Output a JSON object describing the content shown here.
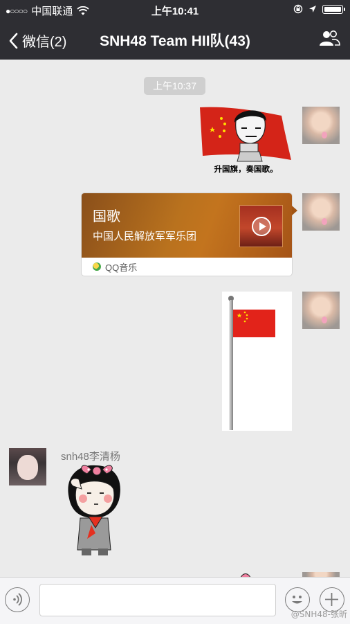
{
  "status_bar": {
    "signal": "●○○○○",
    "carrier": "中国联通",
    "time": "上午10:41"
  },
  "nav": {
    "back_label": "微信(2)",
    "title": "SNH48 Team HII队(43)"
  },
  "messages": {
    "timestamp": "上午10:37",
    "sticker1_caption": "升国旗，奏国歌。",
    "music": {
      "title": "国歌",
      "artist": "中国人民解放军军乐团",
      "source": "QQ音乐"
    },
    "sender_name": "snh48李清杨"
  },
  "colors": {
    "nav_bg": "#2e2e33",
    "chat_bg": "#ebebeb",
    "flag_red": "#e2231a",
    "flag_yellow": "#ffde00"
  },
  "icons": {
    "wifi": "wifi-icon",
    "lock": "rotation-lock-icon",
    "location": "location-arrow-icon",
    "battery": "battery-icon",
    "people": "group-members-icon",
    "voice": "voice-icon",
    "emoji": "emoji-icon",
    "plus": "plus-icon"
  },
  "watermark": "@SNH48-张昕"
}
